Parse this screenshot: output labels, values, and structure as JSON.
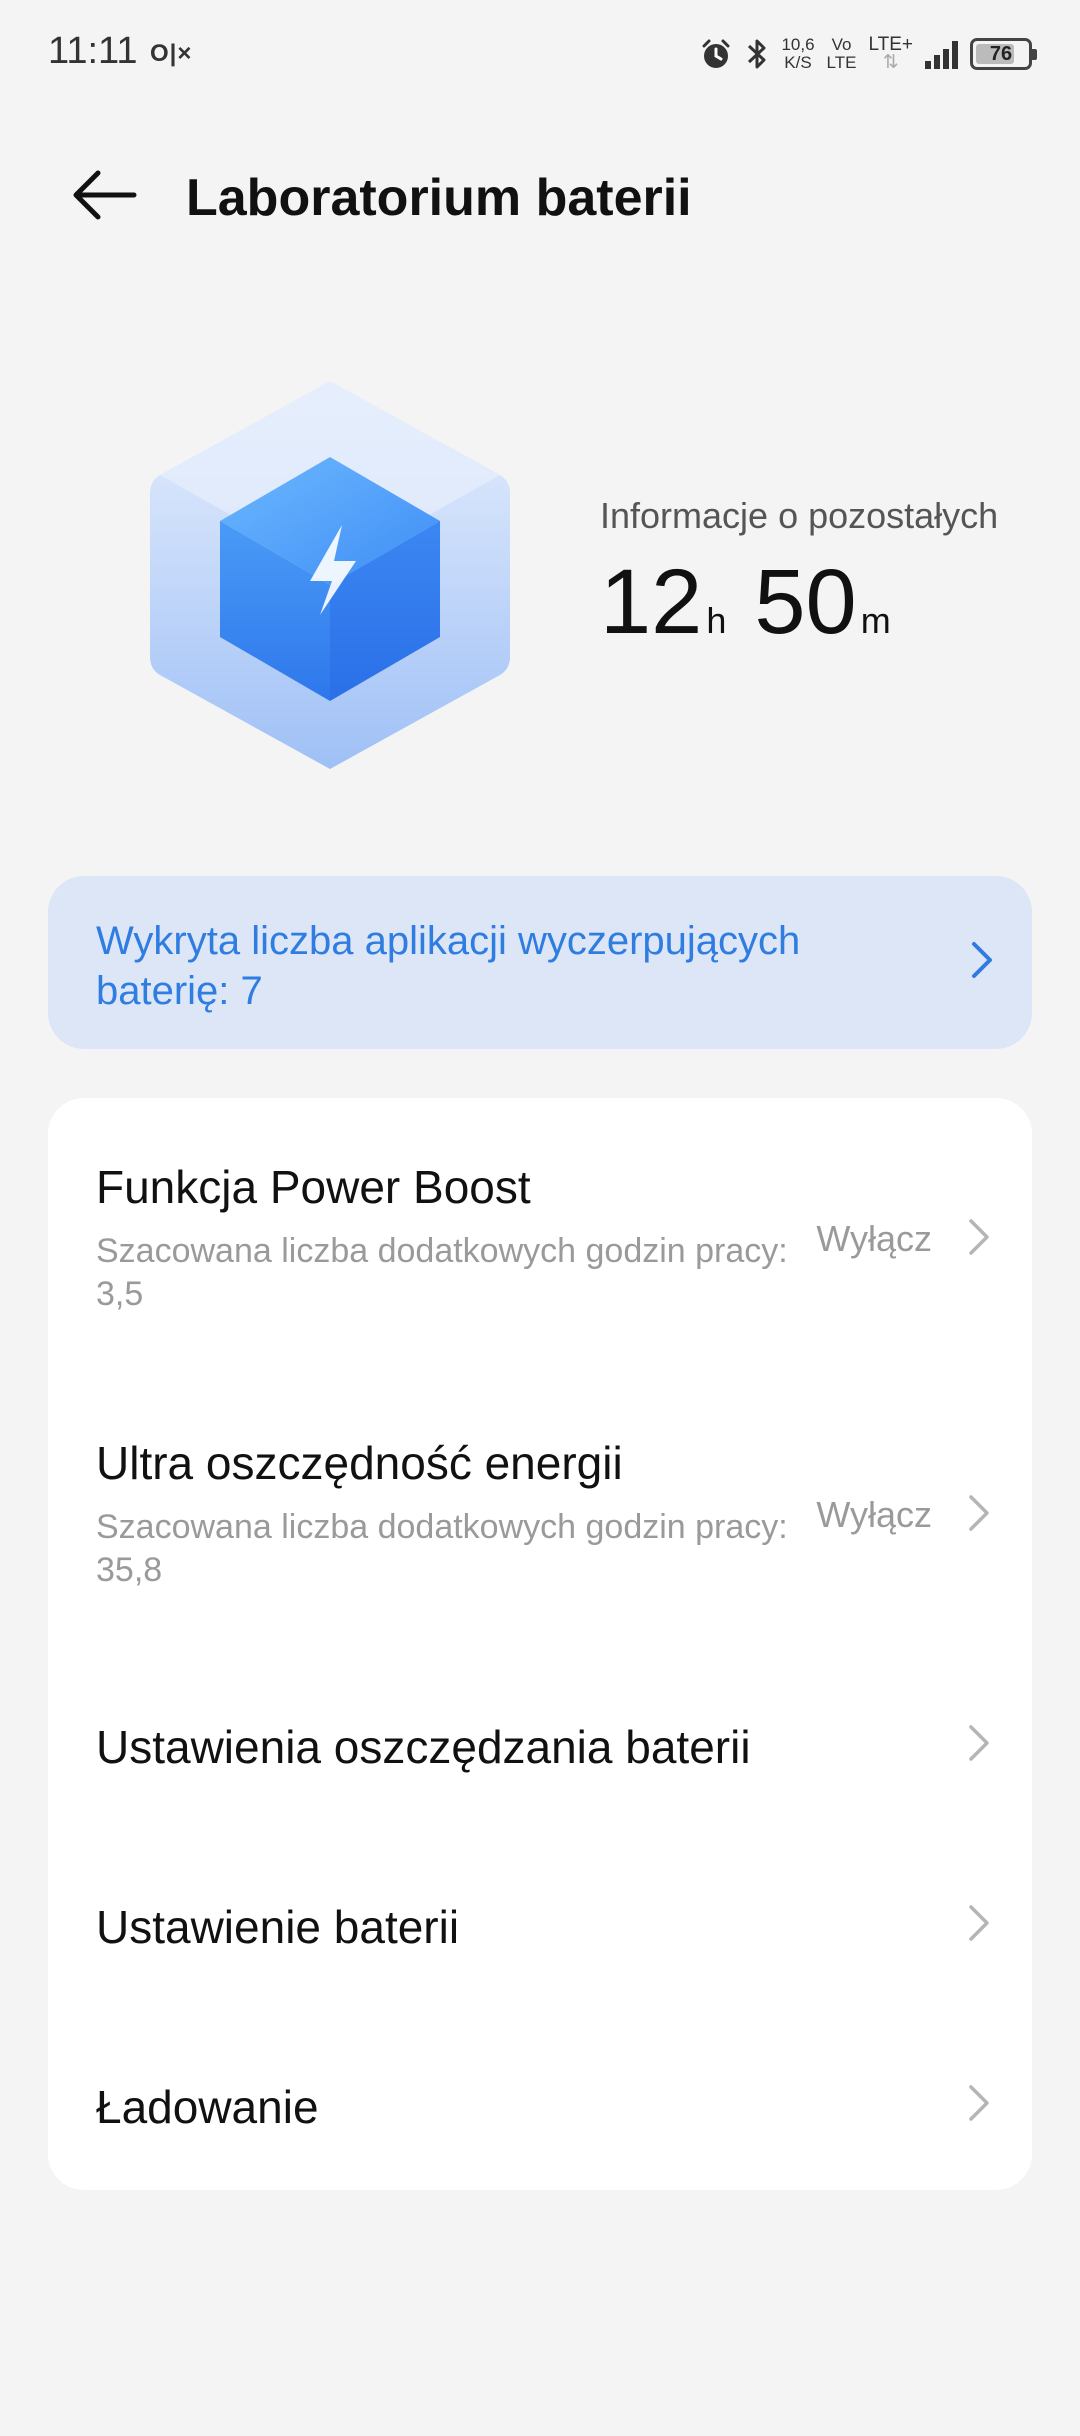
{
  "status_bar": {
    "time": "11:11",
    "notif_icons": "O|×",
    "speed_value": "10,6",
    "speed_unit": "K/S",
    "volte_top": "Vo",
    "volte_bottom": "LTE",
    "network": "LTE+",
    "battery_level": "76",
    "battery_fraction": 0.76
  },
  "header": {
    "title": "Laboratorium baterii"
  },
  "hero": {
    "info_label": "Informacje o pozostałych",
    "hours": "12",
    "hours_unit": "h",
    "minutes": "50",
    "minutes_unit": "m"
  },
  "alert": {
    "text": "Wykryta liczba aplikacji wyczerpujących baterię: 7"
  },
  "settings": {
    "items": [
      {
        "title": "Funkcja Power Boost",
        "subtitle": "Szacowana liczba dodatkowych godzin pracy: 3,5",
        "value": "Wyłącz"
      },
      {
        "title": "Ultra oszczędność energii",
        "subtitle": "Szacowana liczba dodatkowych godzin pracy: 35,8",
        "value": "Wyłącz"
      },
      {
        "title": "Ustawienia oszczędzania baterii"
      },
      {
        "title": "Ustawienie baterii"
      },
      {
        "title": "Ładowanie"
      }
    ]
  },
  "colors": {
    "background": "#f4f4f4",
    "accent": "#2f7de1",
    "alert_bg": "#dce6f6",
    "secondary_text": "#9a9a9a"
  }
}
